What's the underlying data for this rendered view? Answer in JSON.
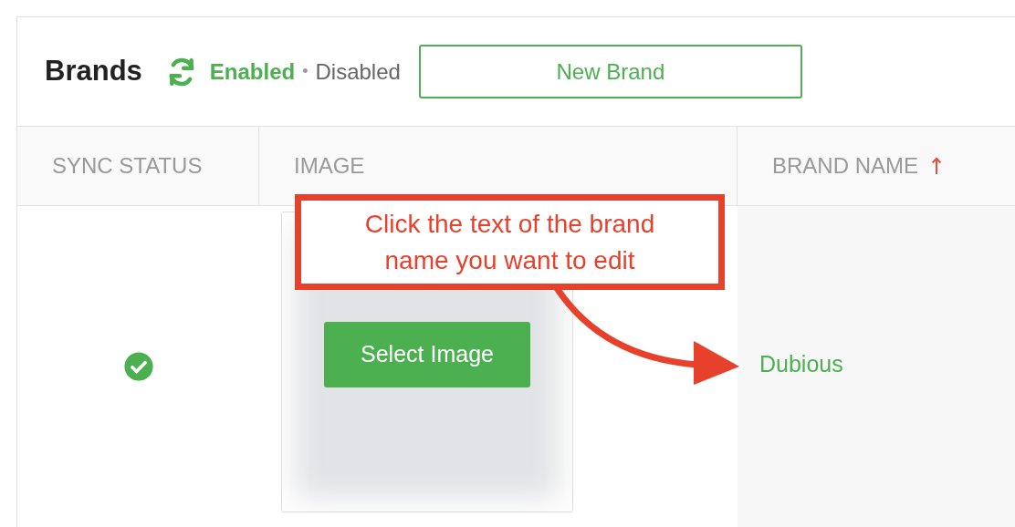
{
  "header": {
    "title": "Brands",
    "filters": [
      {
        "label": "Enabled",
        "selected": true
      },
      {
        "label": "Disabled",
        "selected": false
      }
    ],
    "separator": "•",
    "new_button": "New Brand"
  },
  "table": {
    "columns": [
      {
        "label": "SYNC STATUS",
        "sorted": false
      },
      {
        "label": "IMAGE",
        "sorted": false
      },
      {
        "label": "BRAND NAME",
        "sorted": true
      }
    ],
    "rows": [
      {
        "synced": true,
        "image_button": "Select Image",
        "brand_name": "Dubious"
      }
    ]
  },
  "callout": {
    "text": "Click the text of the brand name you want to edit"
  }
}
